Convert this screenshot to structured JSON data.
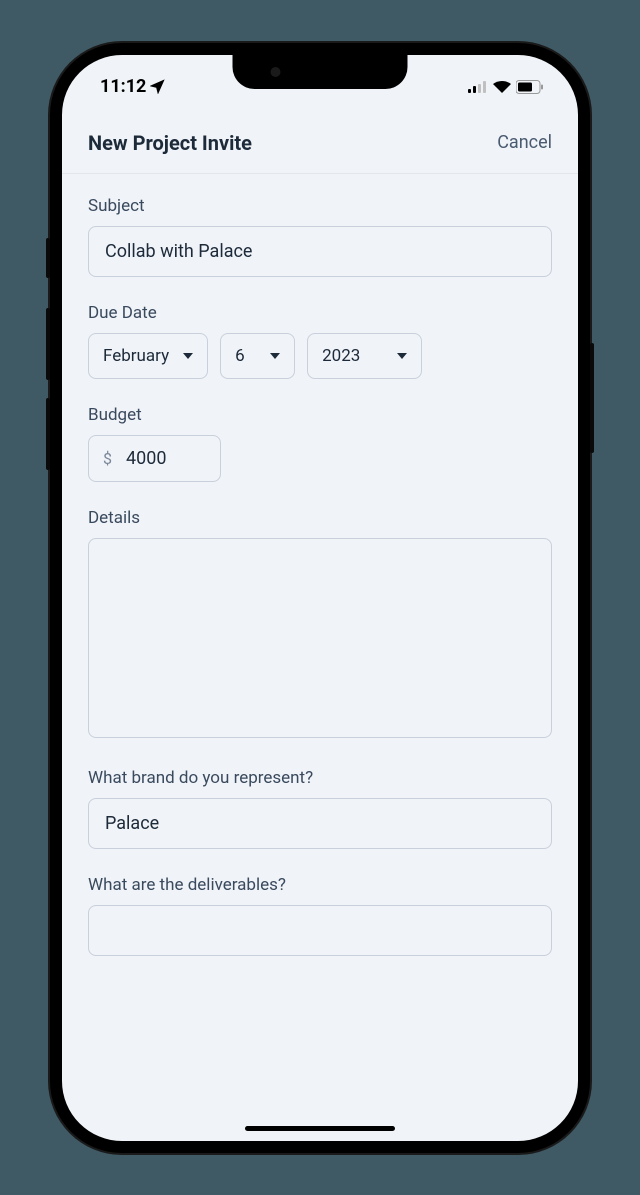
{
  "status": {
    "time": "11:12"
  },
  "header": {
    "title": "New Project Invite",
    "cancel": "Cancel"
  },
  "form": {
    "subject": {
      "label": "Subject",
      "value": "Collab with Palace"
    },
    "due_date": {
      "label": "Due Date",
      "month": "February",
      "day": "6",
      "year": "2023"
    },
    "budget": {
      "label": "Budget",
      "currency": "$",
      "value": "4000"
    },
    "details": {
      "label": "Details",
      "value": ""
    },
    "brand": {
      "label": "What brand do you represent?",
      "value": "Palace"
    },
    "deliverables": {
      "label": "What are the deliverables?",
      "value": ""
    }
  }
}
